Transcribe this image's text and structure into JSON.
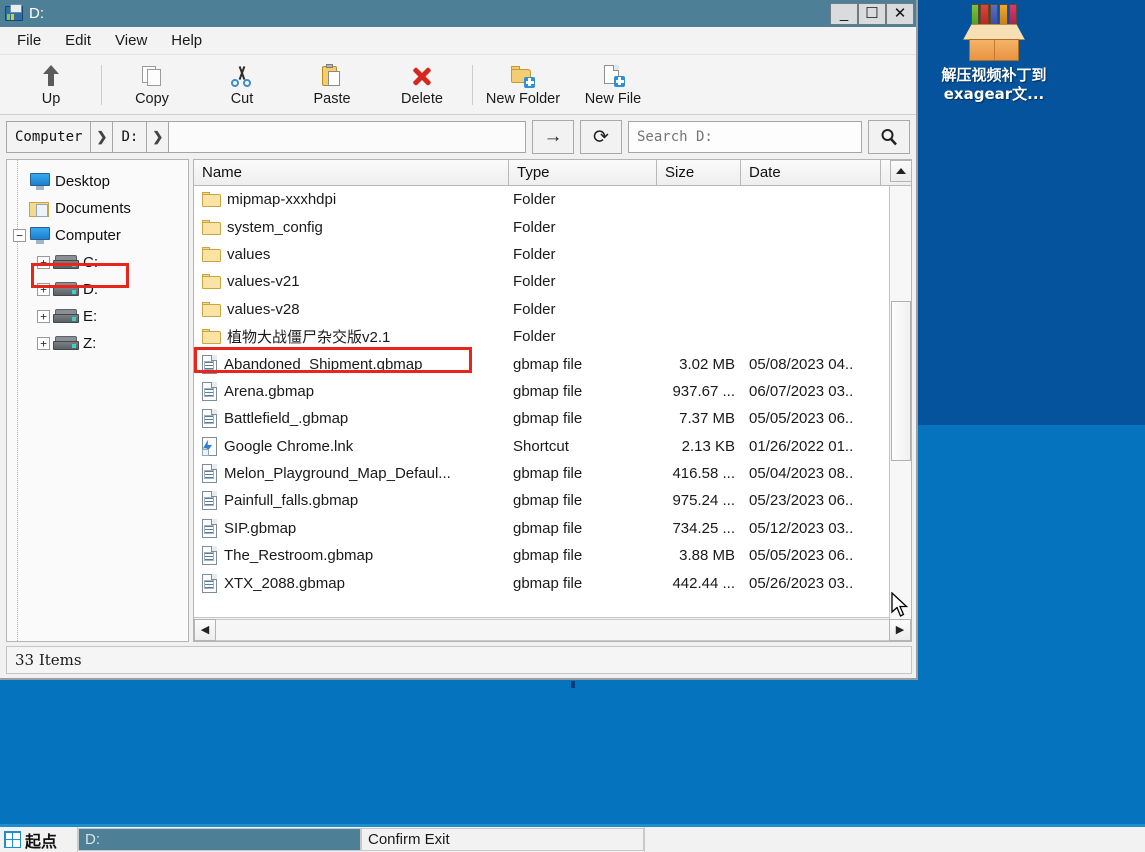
{
  "window": {
    "title": "D:",
    "title_icon": "folder-computer-icon",
    "buttons": {
      "minimize": "_",
      "maximize": "☐",
      "close": "✕"
    }
  },
  "menubar": {
    "items": [
      "File",
      "Edit",
      "View",
      "Help"
    ]
  },
  "toolbar": {
    "buttons": [
      {
        "label": "Up",
        "icon": "arrow-up-icon"
      },
      {
        "label": "Copy",
        "icon": "copy-pages-icon"
      },
      {
        "label": "Cut",
        "icon": "scissors-icon"
      },
      {
        "label": "Paste",
        "icon": "clipboard-paste-icon"
      },
      {
        "label": "Delete",
        "icon": "red-x-icon"
      },
      {
        "label": "New Folder",
        "icon": "folder-plus-icon"
      },
      {
        "label": "New File",
        "icon": "file-plus-icon"
      }
    ]
  },
  "navbar": {
    "breadcrumbs": [
      "Computer",
      "D:"
    ],
    "separator": "❯",
    "path_value": "",
    "go_icon": "→",
    "refresh_icon": "⟳",
    "search_placeholder": "Search D:",
    "search_value": "",
    "search_icon": "magnifier-icon"
  },
  "tree": {
    "nodes": [
      {
        "label": "Desktop",
        "icon": "monitor-icon",
        "expander": "",
        "indent": 1
      },
      {
        "label": "Documents",
        "icon": "documents-folder-icon",
        "expander": "",
        "indent": 1
      },
      {
        "label": "Computer",
        "icon": "monitor-icon",
        "expander": "−",
        "indent": 0
      },
      {
        "label": "C:",
        "icon": "drive-icon",
        "expander": "+",
        "indent": 1
      },
      {
        "label": "D:",
        "icon": "drive-icon",
        "expander": "+",
        "indent": 1,
        "highlighted": true
      },
      {
        "label": "E:",
        "icon": "drive-icon",
        "expander": "+",
        "indent": 1
      },
      {
        "label": "Z:",
        "icon": "drive-icon",
        "expander": "+",
        "indent": 1
      }
    ]
  },
  "filelist": {
    "columns": [
      "Name",
      "Type",
      "Size",
      "Date"
    ],
    "sort_indicator": "ascending-triangle-icon",
    "rows": [
      {
        "name": "mipmap-xxxhdpi",
        "type": "Folder",
        "size": "",
        "date": "",
        "icon": "folder-icon"
      },
      {
        "name": "system_config",
        "type": "Folder",
        "size": "",
        "date": "",
        "icon": "folder-icon"
      },
      {
        "name": "values",
        "type": "Folder",
        "size": "",
        "date": "",
        "icon": "folder-icon"
      },
      {
        "name": "values-v21",
        "type": "Folder",
        "size": "",
        "date": "",
        "icon": "folder-icon"
      },
      {
        "name": "values-v28",
        "type": "Folder",
        "size": "",
        "date": "",
        "icon": "folder-icon"
      },
      {
        "name": "植物大战僵尸杂交版v2.1",
        "type": "Folder",
        "size": "",
        "date": "",
        "icon": "folder-icon",
        "highlighted": true
      },
      {
        "name": "Abandoned_Shipment.gbmap",
        "type": "gbmap file",
        "size": "3.02 MB",
        "date": "05/08/2023 04..",
        "icon": "gbmap-file-icon"
      },
      {
        "name": "Arena.gbmap",
        "type": "gbmap file",
        "size": "937.67 ...",
        "date": "06/07/2023 03..",
        "icon": "gbmap-file-icon"
      },
      {
        "name": "Battlefield_.gbmap",
        "type": "gbmap file",
        "size": "7.37 MB",
        "date": "05/05/2023 06..",
        "icon": "gbmap-file-icon"
      },
      {
        "name": "Google Chrome.lnk",
        "type": "Shortcut",
        "size": "2.13 KB",
        "date": "01/26/2022 01..",
        "icon": "shortcut-icon"
      },
      {
        "name": "Melon_Playground_Map_Defaul...",
        "type": "gbmap file",
        "size": "416.58 ...",
        "date": "05/04/2023 08..",
        "icon": "gbmap-file-icon"
      },
      {
        "name": "Painfull_falls.gbmap",
        "type": "gbmap file",
        "size": "975.24 ...",
        "date": "05/23/2023 06..",
        "icon": "gbmap-file-icon"
      },
      {
        "name": "SIP.gbmap",
        "type": "gbmap file",
        "size": "734.25 ...",
        "date": "05/12/2023 03..",
        "icon": "gbmap-file-icon"
      },
      {
        "name": "The_Restroom.gbmap",
        "type": "gbmap file",
        "size": "3.88 MB",
        "date": "05/05/2023 06..",
        "icon": "gbmap-file-icon"
      },
      {
        "name": "XTX_2088.gbmap",
        "type": "gbmap file",
        "size": "442.44 ...",
        "date": "05/26/2023 03..",
        "icon": "gbmap-file-icon"
      }
    ],
    "hscroll_left": "◀",
    "hscroll_right": "▶"
  },
  "statusbar": {
    "text": "33 Items"
  },
  "desktop": {
    "icon": {
      "label": "解压视频补丁到exagear文...",
      "icon": "open-box-icon"
    },
    "bg_top": "#04539c",
    "bg_bottom": "#0573bd"
  },
  "taskbar": {
    "start_label": "起点",
    "start_icon": "windows-logo-icon",
    "items": [
      {
        "label": "D:",
        "active": true
      },
      {
        "label": "Confirm Exit",
        "active": false
      }
    ],
    "accent": "#1f8ccd"
  },
  "highlight_color": "#e8241b"
}
